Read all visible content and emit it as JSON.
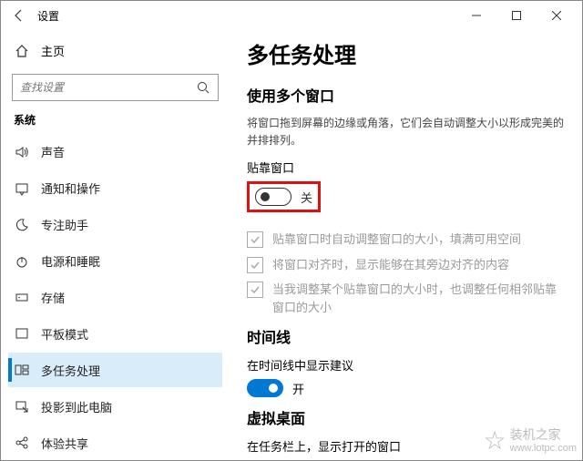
{
  "window": {
    "title": "设置"
  },
  "sidebar": {
    "home": "主页",
    "search_placeholder": "查找设置",
    "group": "系统",
    "items": [
      {
        "label": "声音"
      },
      {
        "label": "通知和操作"
      },
      {
        "label": "专注助手"
      },
      {
        "label": "电源和睡眠"
      },
      {
        "label": "存储"
      },
      {
        "label": "平板模式"
      },
      {
        "label": "多任务处理"
      },
      {
        "label": "投影到此电脑"
      },
      {
        "label": "体验共享"
      }
    ]
  },
  "main": {
    "title": "多任务处理",
    "section1": {
      "heading": "使用多个窗口",
      "desc": "将窗口拖到屏幕的边缘或角落，它们会自动调整大小以形成完美的并排排列。",
      "snap_label": "贴靠窗口",
      "snap_toggle_text": "关",
      "checks": [
        "贴靠窗口时自动调整窗口的大小，填满可用空间",
        "将窗口对齐时，显示能够在其旁边对齐的内容",
        "当我调整某个贴靠窗口的大小时，也调整任何相邻贴靠窗口的大小"
      ]
    },
    "section2": {
      "heading": "时间线",
      "label": "在时间线中显示建议",
      "toggle_text": "开"
    },
    "section3": {
      "heading": "虚拟桌面",
      "label": "在任务栏上，显示打开的窗口"
    }
  },
  "watermark": {
    "cn": "装机之家",
    "url": "www.lotpc.com"
  }
}
